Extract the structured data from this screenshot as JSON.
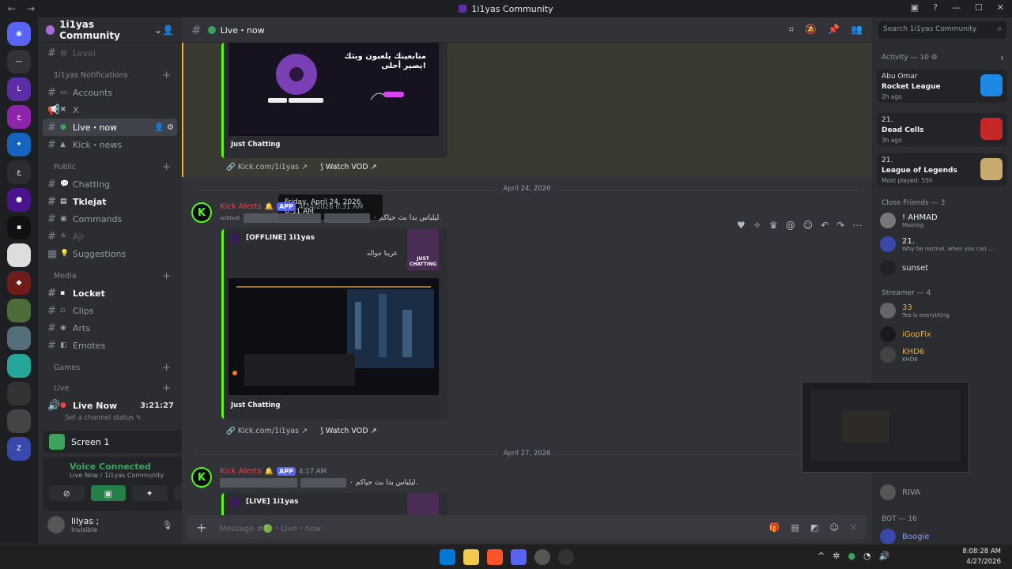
{
  "window": {
    "title": "1i1yas Community",
    "back": "←",
    "forward": "→"
  },
  "server": {
    "name": "1i1yas Community"
  },
  "sidebar": {
    "channels": [
      {
        "label": "Level",
        "emoji": "📊",
        "style": "dim",
        "y": 0
      },
      {
        "category": "1i1yas Notifications"
      },
      {
        "label": "Accounts",
        "emoji": "💻"
      },
      {
        "label": "X",
        "emoji": "✖"
      },
      {
        "label": "Live・now",
        "emoji": "🟢",
        "active": true
      },
      {
        "label": "Kick・news",
        "emoji": "🍕"
      },
      {
        "category": "Public"
      },
      {
        "label": "Chatting",
        "emoji": "💬"
      },
      {
        "label": "Tklejat",
        "emoji": "📋",
        "bold": true
      },
      {
        "label": "Commands",
        "emoji": "🤖"
      },
      {
        "label": "Ajr",
        "emoji": "🌿",
        "style": "dim"
      },
      {
        "label": "Suggestions",
        "emoji": "💡"
      },
      {
        "category": "Media"
      },
      {
        "label": "Locket",
        "emoji": "📷",
        "bold": true
      },
      {
        "label": "Clips",
        "emoji": "🎞"
      },
      {
        "label": "Arts",
        "emoji": "🎨"
      },
      {
        "label": "Emotes",
        "emoji": "🧩"
      },
      {
        "category": "Games"
      },
      {
        "category": "Live"
      }
    ],
    "live_now": {
      "label": "Live Now",
      "time": "3:21:27",
      "status": "Set a channel status"
    }
  },
  "screen_panel": {
    "label": "Screen 1"
  },
  "voice": {
    "status": "Voice Connected",
    "sub": "Live Now / 1i1yas Community"
  },
  "user": {
    "name": "lilyas ;",
    "status": "Invisible"
  },
  "channel_header": {
    "name": "Live・now"
  },
  "messages": {
    "embed1_caption": "Just Chatting",
    "embed1_art_text": "متابعينك يلعبون وبثك يصير أحلى!",
    "kick_link": "Kick.com/1i1yas",
    "watch_vod": "Watch VOD",
    "tooltip": "Friday, April 24, 2026 6:31 AM",
    "divider1": "April 24, 2026",
    "divider2": "April 27, 2026",
    "author": "Kick Alerts",
    "app_badge": "APP",
    "ts1": "4/24/2026 6:31 AM",
    "ts2": "4:17 AM",
    "edited": "(edited)",
    "arabic_line": "ليلياس بدا بث حياكم ٠.",
    "offline_title": "[OFFLINE] 1i1yas",
    "offline_desc": "عرينا جواله",
    "embed2_caption": "Just Chatting",
    "live_title": "[LIVE] 1i1yas",
    "thumb_label": "JUST CHATTING"
  },
  "composer": {
    "placeholder": "Message #🟢・Live・now"
  },
  "search": {
    "placeholder": "Search 1i1yas Community"
  },
  "activity": {
    "title": "Activity — 10",
    "cards": [
      {
        "who": "Abu Omar",
        "game": "Rocket League",
        "when": "2h ago",
        "color": "#1e88e5"
      },
      {
        "who": "21.",
        "game": "Dead Cells",
        "when": "3h ago",
        "color": "#c62828"
      },
      {
        "who": "21.",
        "game": "League of Legends",
        "when": "Most played: 55h",
        "color": "#c8aa6e"
      }
    ]
  },
  "members": {
    "close_friends_title": "Close Friends — 3",
    "streamer_title": "Streamer — 4",
    "bot_title": "BOT — 16",
    "list": [
      {
        "name": "! AHMAD",
        "sub": "Maznog",
        "color": "#f2f3f5"
      },
      {
        "name": "21.",
        "sub": "Why be normal, when you can ...",
        "color": "#f2f3f5"
      },
      {
        "name": "sunset",
        "sub": "",
        "color": "#dbdee1"
      },
      {
        "name": "33",
        "sub": "Tea is everything.",
        "color": "#f0b232"
      },
      {
        "name": "iGopFix",
        "sub": "",
        "color": "#f0b232"
      },
      {
        "name": "KHD6",
        "sub": "KHD6",
        "color": "#f0b232"
      },
      {
        "name": "RIVA",
        "sub": "",
        "color": "#949ba4"
      },
      {
        "name": "Boogie",
        "sub": "",
        "color": "#5865f2"
      }
    ]
  },
  "taskbar": {
    "time": "8:08:28 AM",
    "date": "4/27/2026"
  }
}
